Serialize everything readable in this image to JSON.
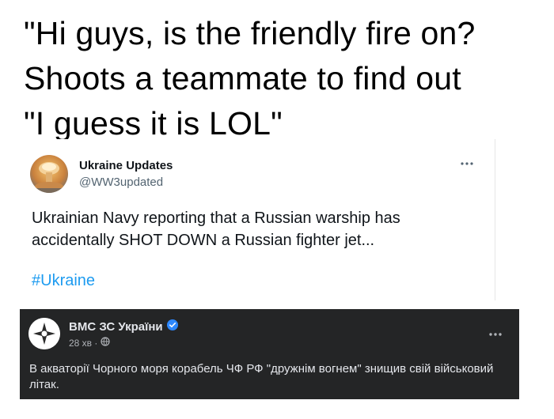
{
  "caption": {
    "lines": [
      "\"Hi guys, is the friendly fire on?",
      "Shoots a teammate to find out",
      "\"I guess it is LOL\""
    ]
  },
  "tweet": {
    "display_name": "Ukraine Updates",
    "handle": "@WW3updated",
    "text": "Ukrainian Navy reporting that a Russian warship has accidentally SHOT DOWN a Russian fighter jet...",
    "hashtag": "#Ukraine",
    "avatar_icon": "mushroom-cloud-avatar",
    "more_icon": "more-options-icon",
    "colors": {
      "link": "#1d9bf0",
      "text": "#0f1419",
      "secondary": "#536471"
    }
  },
  "facebook_post": {
    "page_name": "ВМС ЗС України",
    "time": "28 хв ·",
    "text": "В акваторії Чорного моря корабель ЧФ РФ \"дружнім вогнем\" знищив свій військовий літак.",
    "verified_icon": "verified-badge-icon",
    "privacy_icon": "globe-icon",
    "avatar_icon": "navy-emblem-avatar",
    "more_icon": "more-options-icon",
    "colors": {
      "background": "#242526",
      "text": "#e4e6eb",
      "secondary": "#b0b3b8",
      "verified": "#2d88ff"
    }
  }
}
